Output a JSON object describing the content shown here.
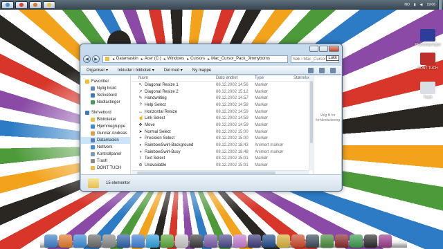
{
  "taskbar": {
    "buttons": [
      {
        "icon": "windows-explorer-icon",
        "color": "#4a8fd0"
      },
      {
        "icon": "chrome-icon",
        "color": "#d9443a"
      },
      {
        "icon": "app-icon",
        "color": "#d87a2a"
      },
      {
        "icon": "folder-icon",
        "color": "#e6bf4b"
      }
    ],
    "language": "NO",
    "time": "19:06"
  },
  "desktop_icons": [
    {
      "label": "Photoshop logos",
      "color": "#2c3e9a"
    },
    {
      "label": "DONT TUCH",
      "color": "#c0302a"
    },
    {
      "label": "Trash",
      "color": "#d8e0e6"
    }
  ],
  "window": {
    "tooltip": "Lukk",
    "breadcrumb": [
      "Datamaskin",
      "Acer (C:)",
      "Windows",
      "Cursors",
      "Mac_Cursor_Pack_Jimmyboms"
    ],
    "search_placeholder": "Søk i Mac_Cursor_...",
    "toolbar": {
      "organize": "Organiser ▾",
      "include": "Inkluder i bibliotek ▾",
      "share": "Del med ▾",
      "new_folder": "Ny mappe"
    },
    "nav": {
      "favorites_header": "Favoritter",
      "favorites": [
        "Nylig brukt",
        "Skrivebord",
        "Nedlastinger"
      ],
      "desktop_header": "Skrivebord",
      "desktop_items": [
        "Biblioteker",
        "Hjemmegruppe",
        "Gunnar Andreas",
        "Datamaskin",
        "Nettverk",
        "Kontrollpanel",
        "Trash",
        "DONT TUCH"
      ],
      "selected": "Datamaskin"
    },
    "columns": {
      "name": "Navn",
      "date": "Dato endret",
      "type": "Type",
      "size": "Størrelse"
    },
    "files": [
      {
        "name": "Diagonal Resize 1",
        "date": "08.12.2002 14:56",
        "type": "Markør",
        "icon": "↖"
      },
      {
        "name": "Diagonal Resize 2",
        "date": "08.12.2002 15:12",
        "type": "Markør",
        "icon": "↗"
      },
      {
        "name": "Handwriting",
        "date": "08.12.2002 14:57",
        "type": "Markør",
        "icon": "✎"
      },
      {
        "name": "Help Select",
        "date": "08.12.2002 14:58",
        "type": "Markør",
        "icon": "?"
      },
      {
        "name": "Horizontal Resize",
        "date": "08.12.2002 14:59",
        "type": "Markør",
        "icon": "↔"
      },
      {
        "name": "Link Select",
        "date": "08.12.2002 14:59",
        "type": "Markør",
        "icon": "☝"
      },
      {
        "name": "Move",
        "date": "08.12.2002 14:59",
        "type": "Markør",
        "icon": "✥"
      },
      {
        "name": "Normal Select",
        "date": "08.12.2002 15:00",
        "type": "Markør",
        "icon": "➤"
      },
      {
        "name": "Precision Select",
        "date": "08.12.2002 15:00",
        "type": "Markør",
        "icon": "+"
      },
      {
        "name": "RainbowSwirl-Background",
        "date": "08.12.2002 18:43",
        "type": "Animert markør",
        "icon": "◐"
      },
      {
        "name": "RainbowSwirl-Busy",
        "date": "08.12.2002 18:48",
        "type": "Animert markør",
        "icon": "◑"
      },
      {
        "name": "Text Select",
        "date": "08.12.2002 15:01",
        "type": "Markør",
        "icon": "I"
      },
      {
        "name": "Unavailable",
        "date": "08.12.2002 15:01",
        "type": "Markør",
        "icon": "⊘"
      }
    ],
    "preview_text": "Velg fil for forhåndsvisning",
    "status": "15 elementer"
  },
  "dock": [
    {
      "icon": "finder-icon",
      "color": "#3c7fc8"
    },
    {
      "icon": "app-icon",
      "color": "#e07a2a"
    },
    {
      "icon": "safari-icon",
      "color": "#3a8ad6"
    },
    {
      "icon": "app-icon",
      "color": "#6a6a6a"
    },
    {
      "icon": "app-icon",
      "color": "#888888"
    },
    {
      "icon": "app-icon",
      "color": "#2d5fa8"
    },
    {
      "icon": "itunes-icon",
      "color": "#3f7fd4"
    },
    {
      "icon": "skype-icon",
      "color": "#2ea0df"
    },
    {
      "icon": "app-icon",
      "color": "#5aa83a"
    },
    {
      "icon": "app-icon",
      "color": "#c9c9c9"
    },
    {
      "icon": "app-icon",
      "color": "#3a3a3a"
    },
    {
      "icon": "app-icon",
      "color": "#7a5aa8"
    },
    {
      "icon": "app-icon",
      "color": "#4a4a8a"
    },
    {
      "icon": "app-icon",
      "color": "#c47ad0"
    },
    {
      "icon": "after-effects-icon",
      "color": "#3b3b7a"
    },
    {
      "icon": "photoshop-icon",
      "color": "#1f4a8a"
    },
    {
      "icon": "app-icon",
      "color": "#d6b03a"
    },
    {
      "icon": "app-icon",
      "color": "#c94a2a"
    },
    {
      "icon": "counter-strike-icon",
      "color": "#3a4a5a"
    },
    {
      "icon": "minecraft-icon",
      "color": "#4a8a3a"
    },
    {
      "icon": "app-icon",
      "color": "#8a2a2a"
    },
    {
      "icon": "app-icon",
      "color": "#3a9a4a"
    },
    {
      "icon": "app-icon",
      "color": "#2a2a2a"
    },
    {
      "icon": "app-icon",
      "color": "#9a3a8a"
    }
  ]
}
